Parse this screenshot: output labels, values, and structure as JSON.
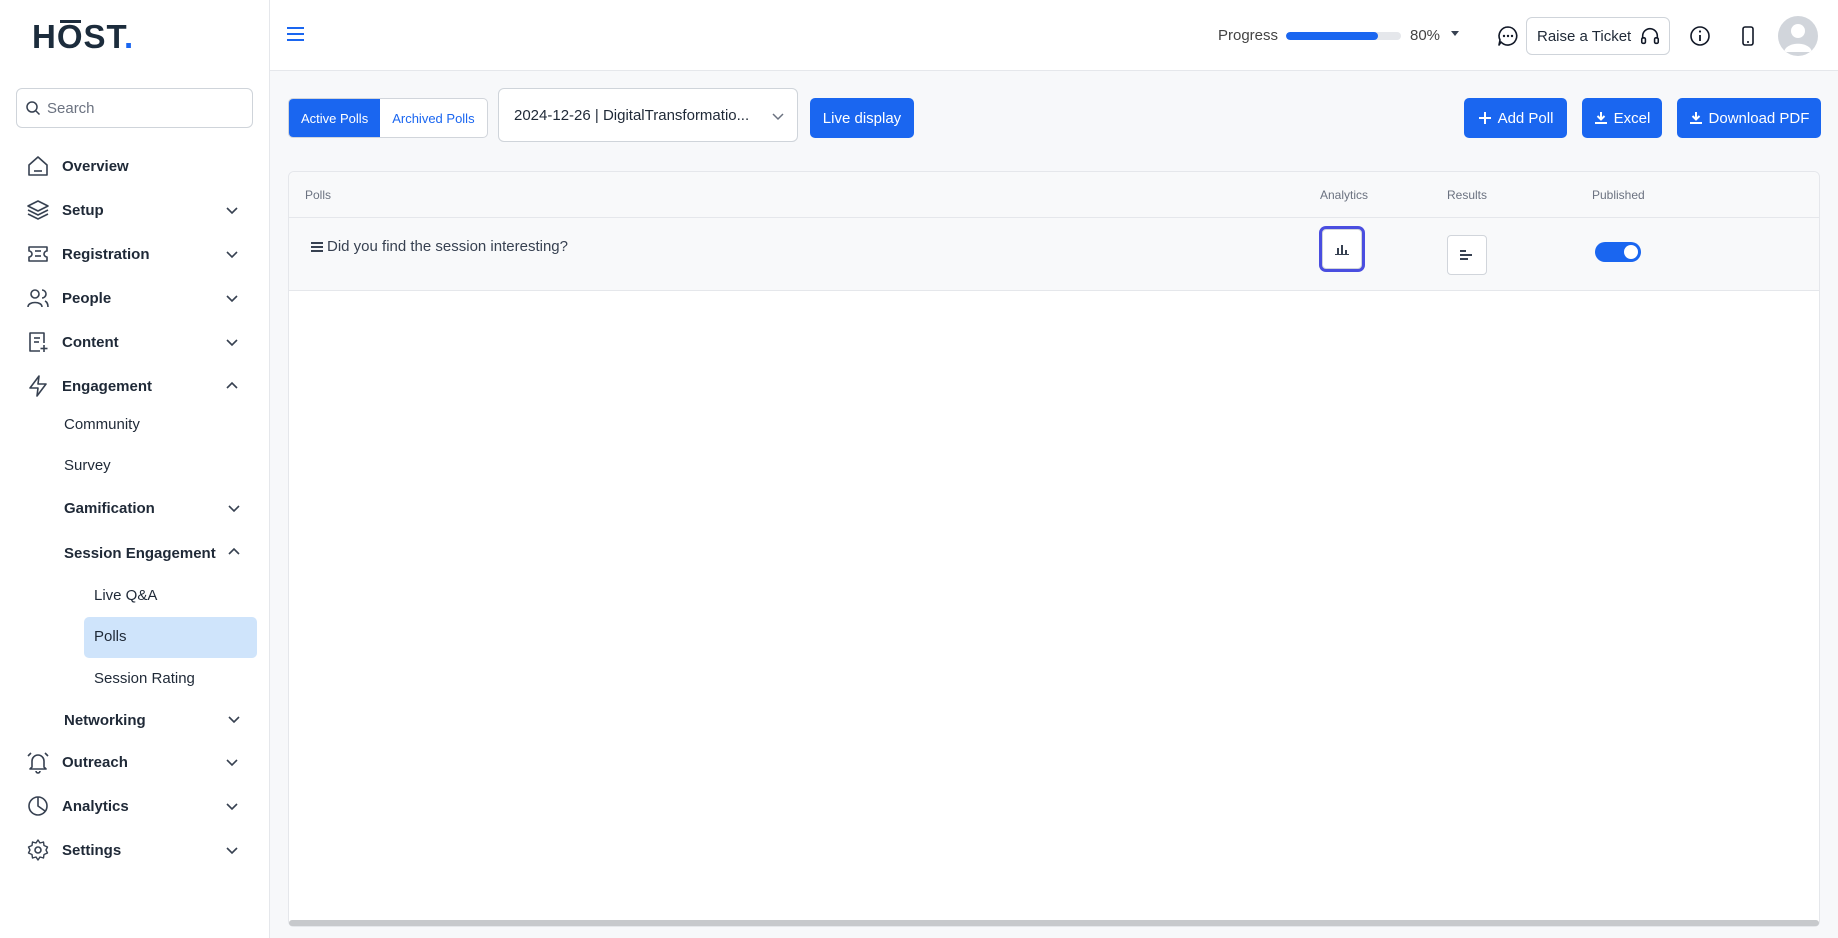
{
  "brand": {
    "logo_h": "H",
    "logo_o": "O",
    "logo_rest": "ST",
    "logo_dot": "."
  },
  "search": {
    "placeholder": "Search"
  },
  "sidebar": {
    "items": [
      {
        "label": "Overview"
      },
      {
        "label": "Setup"
      },
      {
        "label": "Registration"
      },
      {
        "label": "People"
      },
      {
        "label": "Content"
      },
      {
        "label": "Engagement"
      },
      {
        "label": "Outreach"
      },
      {
        "label": "Analytics"
      },
      {
        "label": "Settings"
      }
    ],
    "engagement_sub": {
      "community": "Community",
      "survey": "Survey",
      "gamification": "Gamification",
      "session_engagement": "Session Engagement",
      "live_qa": "Live Q&A",
      "polls": "Polls",
      "session_rating": "Session Rating",
      "networking": "Networking"
    }
  },
  "header": {
    "progress_label": "Progress",
    "progress_value": 0.8,
    "progress_text": "80%",
    "ticket_label": "Raise a Ticket"
  },
  "toolbar": {
    "active_tab": "Active Polls",
    "archived_tab": "Archived Polls",
    "session_select": "2024-12-26 | DigitalTransformatio...",
    "live_display": "Live display",
    "add_poll": "Add Poll",
    "excel": "Excel",
    "download_pdf": "Download PDF"
  },
  "table": {
    "columns": {
      "polls": "Polls",
      "analytics": "Analytics",
      "results": "Results",
      "published": "Published"
    },
    "rows": [
      {
        "question": "Did you find the session interesting?",
        "published": true
      }
    ]
  },
  "colors": {
    "accent": "#1a66f0",
    "active_bg": "#cfe4fb",
    "focus_ring": "#4a4ee0"
  }
}
